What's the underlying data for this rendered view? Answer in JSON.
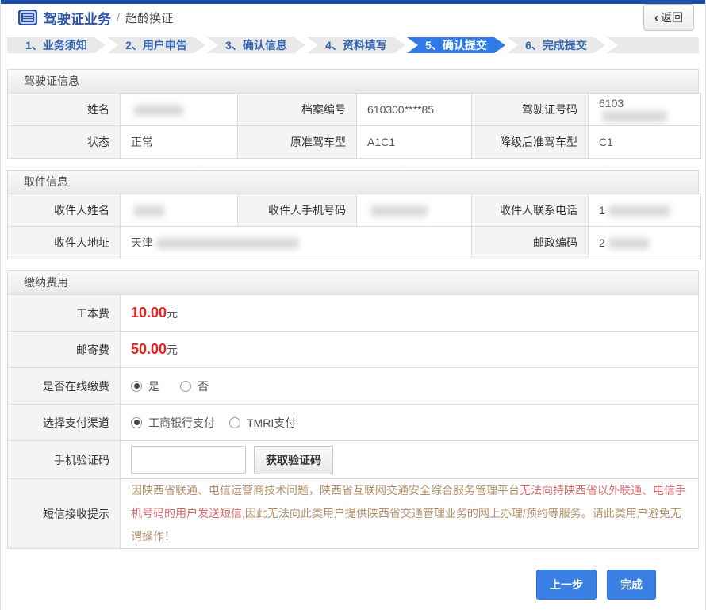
{
  "header": {
    "title": "驾驶证业务",
    "separator": "/",
    "subtitle": "超龄换证",
    "back_icon": "‹",
    "back_label": "返回"
  },
  "steps": [
    {
      "label": "1、业务须知",
      "active": false
    },
    {
      "label": "2、用户申告",
      "active": false
    },
    {
      "label": "3、确认信息",
      "active": false
    },
    {
      "label": "4、资料填写",
      "active": false
    },
    {
      "label": "5、确认提交",
      "active": true
    },
    {
      "label": "6、完成提交",
      "active": false
    }
  ],
  "license_info": {
    "title": "驾驶证信息",
    "name_label": "姓名",
    "name_value": "",
    "file_no_label": "档案编号",
    "file_no_value": "610300****85",
    "license_no_label": "驾驶证号码",
    "license_no_value": "6103",
    "status_label": "状态",
    "status_value": "正常",
    "orig_class_label": "原准驾车型",
    "orig_class_value": "A1C1",
    "down_class_label": "降级后准驾车型",
    "down_class_value": "C1"
  },
  "pickup_info": {
    "title": "取件信息",
    "recipient_name_label": "收件人姓名",
    "recipient_name_value": "",
    "recipient_mobile_label": "收件人手机号码",
    "recipient_mobile_value": "",
    "recipient_tel_label": "收件人联系电话",
    "recipient_tel_value": "1",
    "recipient_addr_label": "收件人地址",
    "recipient_addr_value": "天津",
    "postcode_label": "邮政编码",
    "postcode_value": "2"
  },
  "payment": {
    "title": "缴纳费用",
    "fee_label": "工本费",
    "fee_amount": "10.00",
    "fee_unit": "元",
    "postage_label": "邮寄费",
    "postage_amount": "50.00",
    "postage_unit": "元",
    "online_pay_label": "是否在线缴费",
    "online_yes": "是",
    "online_no": "否",
    "online_selected": "是",
    "channel_label": "选择支付渠道",
    "channel_icbc": "工商银行支付",
    "channel_tmri": "TMRI支付",
    "channel_selected": "工商银行支付",
    "sms_code_label": "手机验证码",
    "sms_code_value": "",
    "get_code_button": "获取验证码",
    "sms_note_label": "短信接收提示",
    "note_part1": "因陕西省联通、电信运营商技术问题，陕西省互联网交通安全综合服务管理平台",
    "note_part2": "无法向持陕西省以外联通、电信手机号码的用户发送短信,",
    "note_part3": "因此无法向此类用户提供陕西省交通管理业务的网上办理/预约等服务。请此类用户避免无谓操作！"
  },
  "footer": {
    "prev_button": "上一步",
    "finish_button": "完成"
  },
  "colors": {
    "topbar_blue": "#1d4ea8",
    "title_blue": "#2b53a8",
    "step_text_blue": "#3465b0",
    "active_step_blue": "#2e7ae6",
    "button_blue": "#3a7fe3",
    "fee_red": "#e8241d",
    "note_tan": "#b2906b",
    "note_red": "#d86a6a"
  }
}
